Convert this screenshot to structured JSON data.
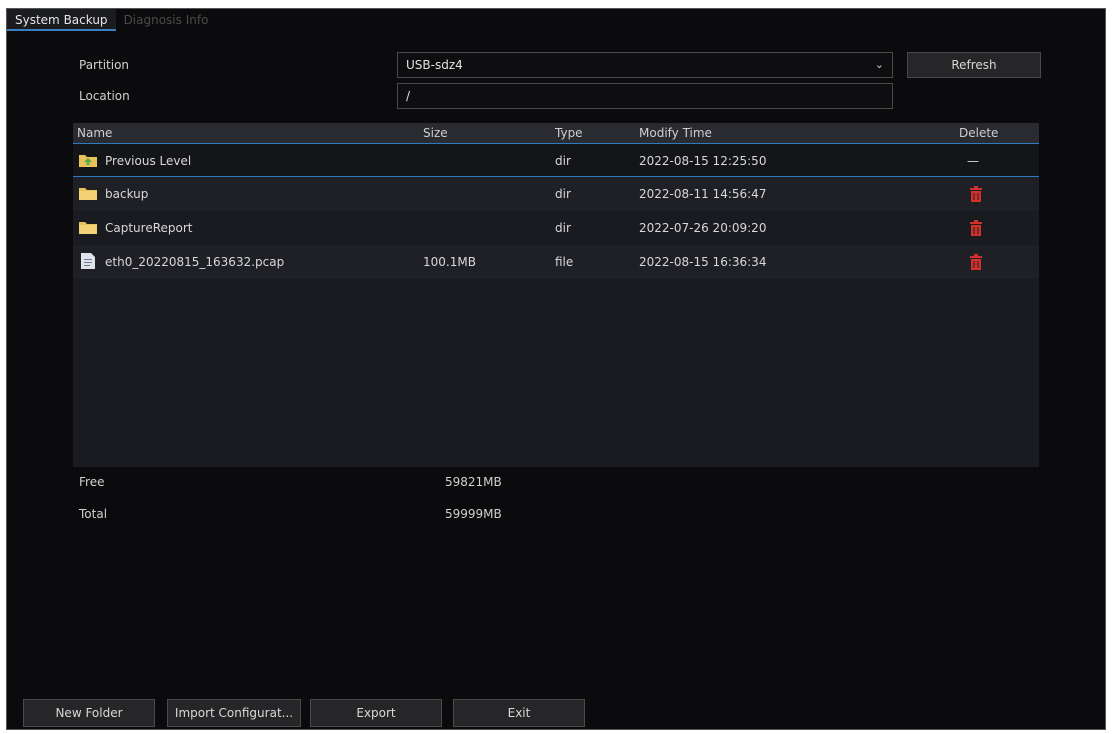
{
  "tabs": [
    {
      "label": "System Backup"
    },
    {
      "label": "Diagnosis Info"
    }
  ],
  "form": {
    "partition_label": "Partition",
    "partition_value": "USB-sdz4",
    "location_label": "Location",
    "location_value": "/",
    "refresh_label": "Refresh"
  },
  "table": {
    "headers": {
      "name": "Name",
      "size": "Size",
      "type": "Type",
      "modify": "Modify Time",
      "delete": "Delete"
    },
    "rows": [
      {
        "name": "Previous Level",
        "size": "",
        "type": "dir",
        "modify": "2022-08-15 12:25:50",
        "delete": "—",
        "icon": "folder-up-icon"
      },
      {
        "name": "backup",
        "size": "",
        "type": "dir",
        "modify": "2022-08-11 14:56:47",
        "icon": "folder-icon"
      },
      {
        "name": "CaptureReport",
        "size": "",
        "type": "dir",
        "modify": "2022-07-26 20:09:20",
        "icon": "folder-icon"
      },
      {
        "name": "eth0_20220815_163632.pcap",
        "size": "100.1MB",
        "type": "file",
        "modify": "2022-08-15 16:36:34",
        "icon": "file-icon"
      }
    ]
  },
  "storage": {
    "free_label": "Free",
    "free_value": "59821MB",
    "total_label": "Total",
    "total_value": "59999MB"
  },
  "buttons": {
    "new_folder": "New Folder",
    "import": "Import Configurat...",
    "export": "Export",
    "exit": "Exit"
  },
  "colors": {
    "accent": "#2f78c4",
    "delete": "#d2302b",
    "folder": "#e8c15a"
  }
}
